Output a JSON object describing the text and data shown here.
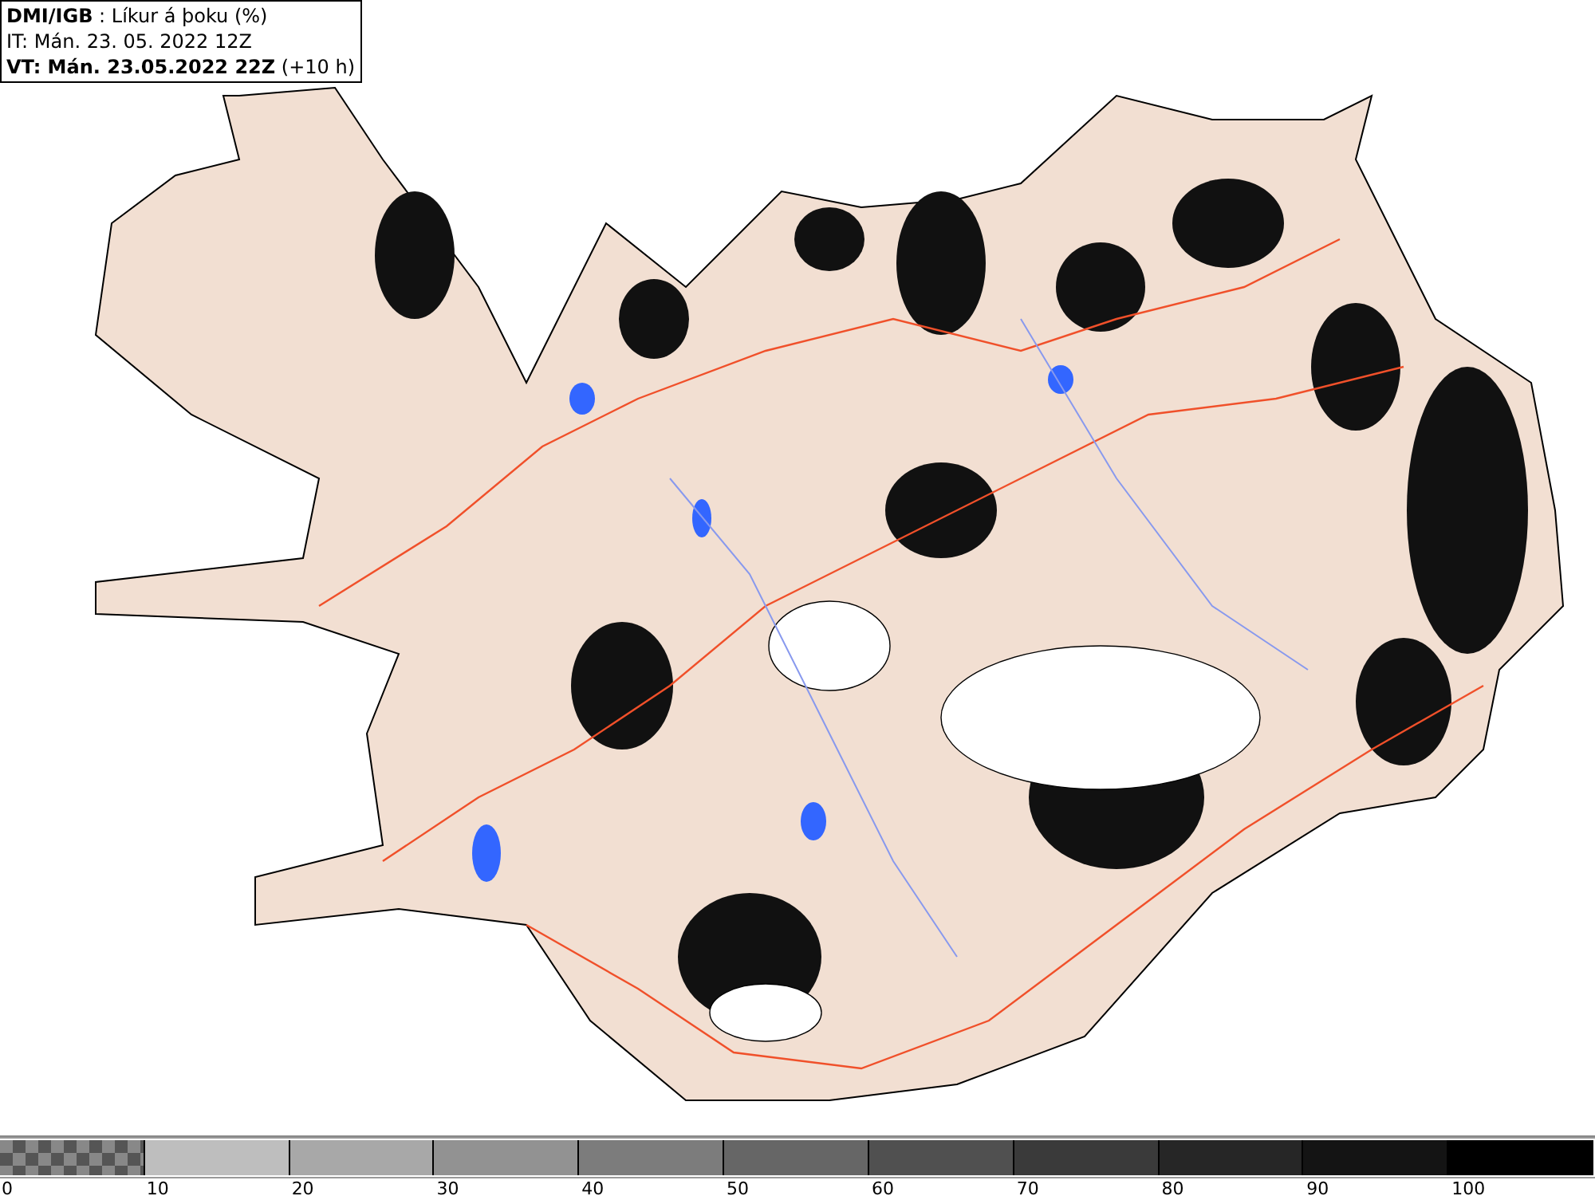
{
  "header": {
    "line_1": "**DMI/IGB** : Líkur á þoku (%)",
    "line_2": "IT: Mán. 23. 05. 2022 12Z",
    "line_3": "**VT: Mán. 23.05.2022 22Z** (+10 h)"
  },
  "legend": {
    "bins": [
      {
        "kind": "checker",
        "color": "#555555"
      },
      {
        "kind": "solid",
        "color": "#bebebe"
      },
      {
        "kind": "solid",
        "color": "#a8a8a8"
      },
      {
        "kind": "solid",
        "color": "#929292"
      },
      {
        "kind": "solid",
        "color": "#7c7c7c"
      },
      {
        "kind": "solid",
        "color": "#666666"
      },
      {
        "kind": "solid",
        "color": "#505050"
      },
      {
        "kind": "solid",
        "color": "#3a3a3a"
      },
      {
        "kind": "solid",
        "color": "#262626"
      },
      {
        "kind": "solid",
        "color": "#141414"
      },
      {
        "kind": "solid",
        "color": "#000000"
      }
    ],
    "ticks": [
      "0",
      "10",
      "20",
      "30",
      "40",
      "50",
      "60",
      "70",
      "80",
      "90",
      "100"
    ]
  }
}
